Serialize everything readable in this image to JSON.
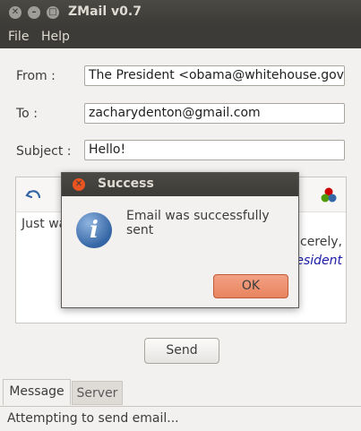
{
  "window": {
    "title": "ZMail v0.7"
  },
  "menu": {
    "file": "File",
    "help": "Help"
  },
  "form": {
    "from_label": "From :",
    "from_value": "The President <obama@whitehouse.gov>",
    "to_label": "To :",
    "to_value": "zacharydenton@gmail.com",
    "subject_label": "Subject :",
    "subject_value": "Hello!"
  },
  "editor": {
    "body_start": "Just wa",
    "body_closing": "ncerely,",
    "signature": "esident"
  },
  "send_label": "Send",
  "tabs": [
    {
      "label": "Message",
      "active": true
    },
    {
      "label": "Server",
      "active": false
    }
  ],
  "status": "Attempting to send email...",
  "dialog": {
    "title": "Success",
    "message": "Email was successfully sent",
    "ok_label": "OK"
  },
  "colors": {
    "accent": "#e95420",
    "ok_button": "#ed8a65",
    "titlebar": "#3c3b37",
    "signature": "#1a1aa6"
  }
}
